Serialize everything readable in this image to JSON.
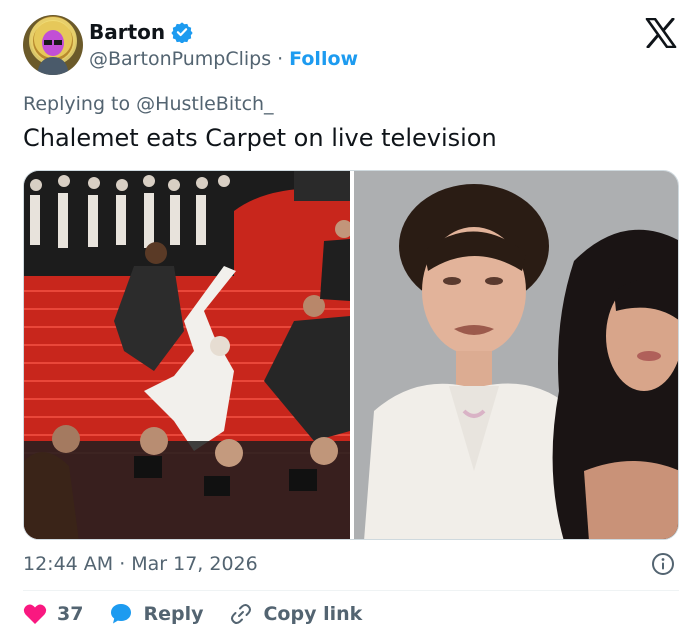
{
  "author": {
    "display_name": "Barton",
    "handle": "@BartonPumpClips",
    "separator": "·",
    "follow_label": "Follow"
  },
  "reply_context": "Replying to @HustleBitch_",
  "tweet": {
    "text": "Chalemet eats Carpet on live television"
  },
  "meta": {
    "time": "12:44 AM",
    "separator": "·",
    "date": "Mar 17, 2026"
  },
  "actions": {
    "like_count": "37",
    "reply_label": "Reply",
    "copy_label": "Copy link"
  },
  "icons": {
    "verified": "verified-badge-icon",
    "x_logo": "x-logo-icon",
    "info": "info-icon",
    "like": "heart-icon",
    "reply": "speech-bubble-icon",
    "copy": "link-icon"
  },
  "colors": {
    "accent": "#1d9bf0",
    "like": "#f91880",
    "text": "#0f1419",
    "secondary": "#536471",
    "carpet": "#c8261c"
  }
}
